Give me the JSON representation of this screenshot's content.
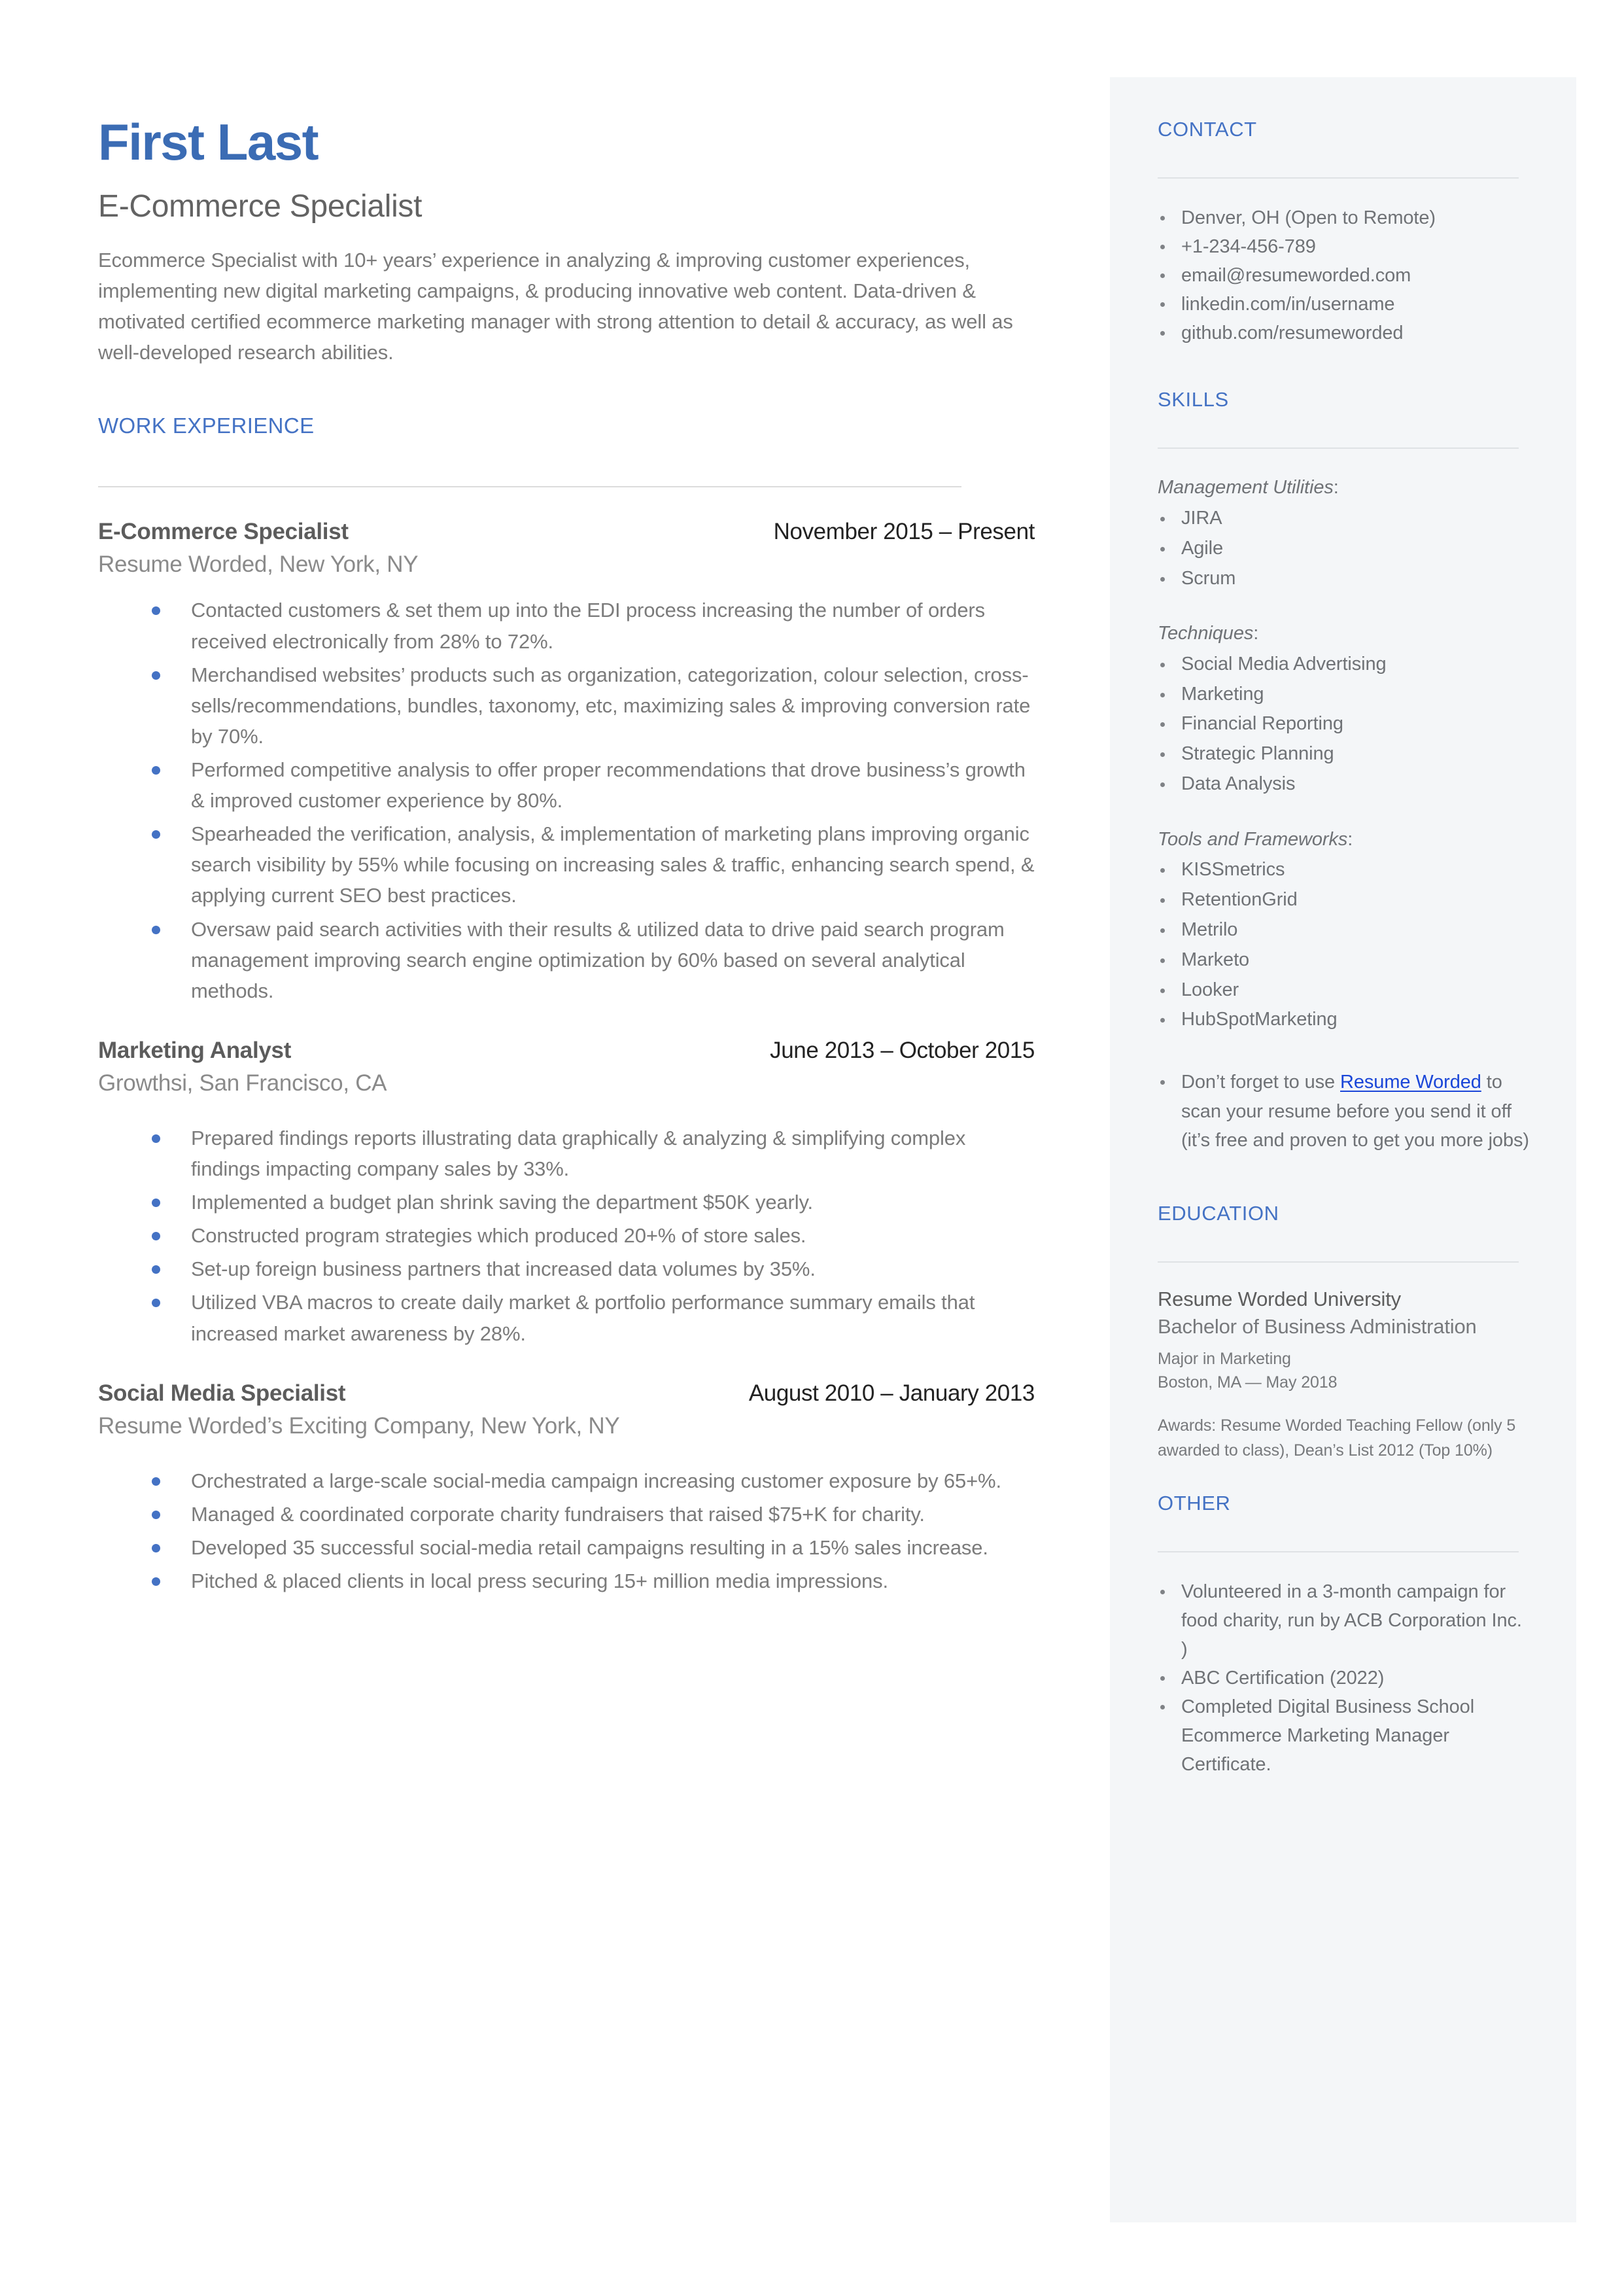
{
  "header": {
    "name": "First Last",
    "title": "E-Commerce Specialist",
    "summary": "Ecommerce Specialist with 10+ years’ experience in analyzing & improving customer experiences, implementing new digital marketing campaigns, & producing innovative web content. Data-driven & motivated certified ecommerce marketing manager with strong attention to detail & accuracy, as well as well-developed research abilities."
  },
  "work": {
    "heading": "WORK EXPERIENCE",
    "jobs": [
      {
        "title": "E-Commerce Specialist",
        "dates": "November 2015 – Present",
        "company": "Resume Worded, New York, NY",
        "bullets": [
          "Contacted customers & set them up into the EDI process increasing the number of orders received electronically from 28% to 72%.",
          "Merchandised websites’ products such as organization, categorization, colour selection, cross-sells/recommendations, bundles, taxonomy, etc, maximizing sales & improving conversion rate by 70%.",
          "Performed competitive analysis to offer proper  recommendations that drove business’s growth & improved customer experience by 80%.",
          "Spearheaded the verification, analysis, & implementation of marketing plans improving organic search visibility by 55% while focusing on increasing sales & traffic, enhancing search spend, & applying current SEO best practices.",
          "Oversaw paid search activities with their results & utilized data to drive paid search program management improving search engine optimization by 60% based on several analytical methods."
        ]
      },
      {
        "title": "Marketing Analyst",
        "dates": "June 2013 – October 2015",
        "company": "Growthsi, San Francisco, CA",
        "bullets": [
          "Prepared findings reports illustrating data graphically & analyzing & simplifying complex findings impacting company sales by 33%.",
          "Implemented a budget plan shrink saving the department $50K yearly.",
          "Constructed program strategies which produced 20+% of store sales.",
          "Set-up foreign business partners that increased data volumes by 35%.",
          "Utilized VBA macros to create daily market & portfolio performance summary emails that increased market awareness by 28%."
        ]
      },
      {
        "title": "Social Media Specialist",
        "dates": "August 2010 – January 2013",
        "company": "Resume Worded’s Exciting Company, New York, NY",
        "bullets": [
          "Orchestrated a large-scale social-media campaign increasing customer exposure by 65+%.",
          "Managed & coordinated corporate charity fundraisers that raised $75+K for charity.",
          "Developed 35 successful social-media retail campaigns resulting in a 15% sales increase.",
          "Pitched & placed clients in local press securing 15+ million media impressions."
        ]
      }
    ]
  },
  "sidebar": {
    "contact": {
      "heading": "CONTACT",
      "items": [
        " Denver, OH (Open to Remote)",
        "+1-234-456-789",
        "email@resumeworded.com",
        "linkedin.com/in/username",
        "github.com/resumeworded"
      ]
    },
    "skills": {
      "heading": "SKILLS",
      "groups": [
        {
          "label": "Management Utilities",
          "items": [
            "JIRA",
            "Agile",
            "Scrum"
          ]
        },
        {
          "label": "Techniques",
          "items": [
            "Social Media Advertising",
            "Marketing",
            "Financial Reporting",
            "Strategic Planning",
            "Data Analysis"
          ]
        },
        {
          "label": "Tools and Frameworks",
          "items": [
            "KISSmetrics",
            "RetentionGrid",
            "Metrilo",
            "Marketo",
            "Looker",
            "HubSpotMarketing"
          ]
        }
      ],
      "note": {
        "before": " Don’t forget to use ",
        "link": "Resume Worded",
        "after": " to scan your resume before you send it off (it’s free and proven to get you more jobs)"
      }
    },
    "education": {
      "heading": "EDUCATION",
      "school": "Resume Worded University",
      "degree": "Bachelor of Business Administration",
      "major": "Major in Marketing",
      "location": "Boston, MA — May 2018",
      "awards": "Awards: Resume Worded Teaching Fellow (only 5 awarded to class), Dean’s List 2012 (Top 10%)"
    },
    "other": {
      "heading": "OTHER",
      "items": [
        " Volunteered in a 3-month campaign for food charity, run by ACB Corporation Inc. )",
        " ABC Certification (2022)",
        " Completed Digital Business School Ecommerce Marketing Manager Certificate."
      ]
    }
  },
  "colors": {
    "accent": "#4472c4",
    "name": "#3b6cb4",
    "link": "#1a46d8",
    "body_text": "#7b7b7b",
    "sidebar_bg": "#f4f6f8"
  }
}
